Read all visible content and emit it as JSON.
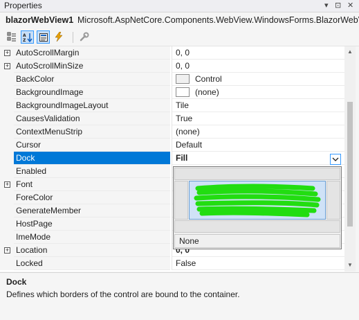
{
  "window": {
    "title": "Properties",
    "controls": [
      "▾",
      "⊡",
      "✕"
    ]
  },
  "object": {
    "name": "blazorWebView1",
    "type": "Microsoft.AspNetCore.Components.WebView.WindowsForms.BlazorWebV"
  },
  "toolbar": {
    "buttons": [
      {
        "name": "categorized-button",
        "icon": "categorized-icon",
        "selected": false
      },
      {
        "name": "alphabetical-button",
        "icon": "sort-az-icon",
        "selected": true
      },
      {
        "name": "properties-button",
        "icon": "properties-icon",
        "selected": true
      },
      {
        "name": "events-button",
        "icon": "lightning-icon",
        "selected": false
      },
      {
        "name": "property-pages-button",
        "icon": "wrench-icon",
        "selected": false
      }
    ]
  },
  "properties": [
    {
      "name": "AutoScrollMargin",
      "value": "0, 0",
      "expandable": true
    },
    {
      "name": "AutoScrollMinSize",
      "value": "0, 0",
      "expandable": true
    },
    {
      "name": "BackColor",
      "value": "Control",
      "swatch": "control"
    },
    {
      "name": "BackgroundImage",
      "value": "(none)",
      "swatch": "blank"
    },
    {
      "name": "BackgroundImageLayout",
      "value": "Tile"
    },
    {
      "name": "CausesValidation",
      "value": "True"
    },
    {
      "name": "ContextMenuStrip",
      "value": "(none)"
    },
    {
      "name": "Cursor",
      "value": "Default"
    },
    {
      "name": "Dock",
      "value": "Fill",
      "selected": true,
      "bold": true
    },
    {
      "name": "Enabled",
      "value": ""
    },
    {
      "name": "Font",
      "value": "",
      "expandable": true
    },
    {
      "name": "ForeColor",
      "value": ""
    },
    {
      "name": "GenerateMember",
      "value": ""
    },
    {
      "name": "HostPage",
      "value": ""
    },
    {
      "name": "ImeMode",
      "value": ""
    },
    {
      "name": "Location",
      "value": "0, 0",
      "expandable": true,
      "bold": true
    },
    {
      "name": "Locked",
      "value": "False"
    }
  ],
  "dock_editor": {
    "none_label": "None",
    "selected_region": "Fill",
    "scribble_color": "#22dd11"
  },
  "description": {
    "title": "Dock",
    "text": "Defines which borders of the control are bound to the container."
  },
  "colors": {
    "selection": "#0078d7",
    "accent_border": "#3399ff",
    "fill_region": "#cfe2f7"
  }
}
